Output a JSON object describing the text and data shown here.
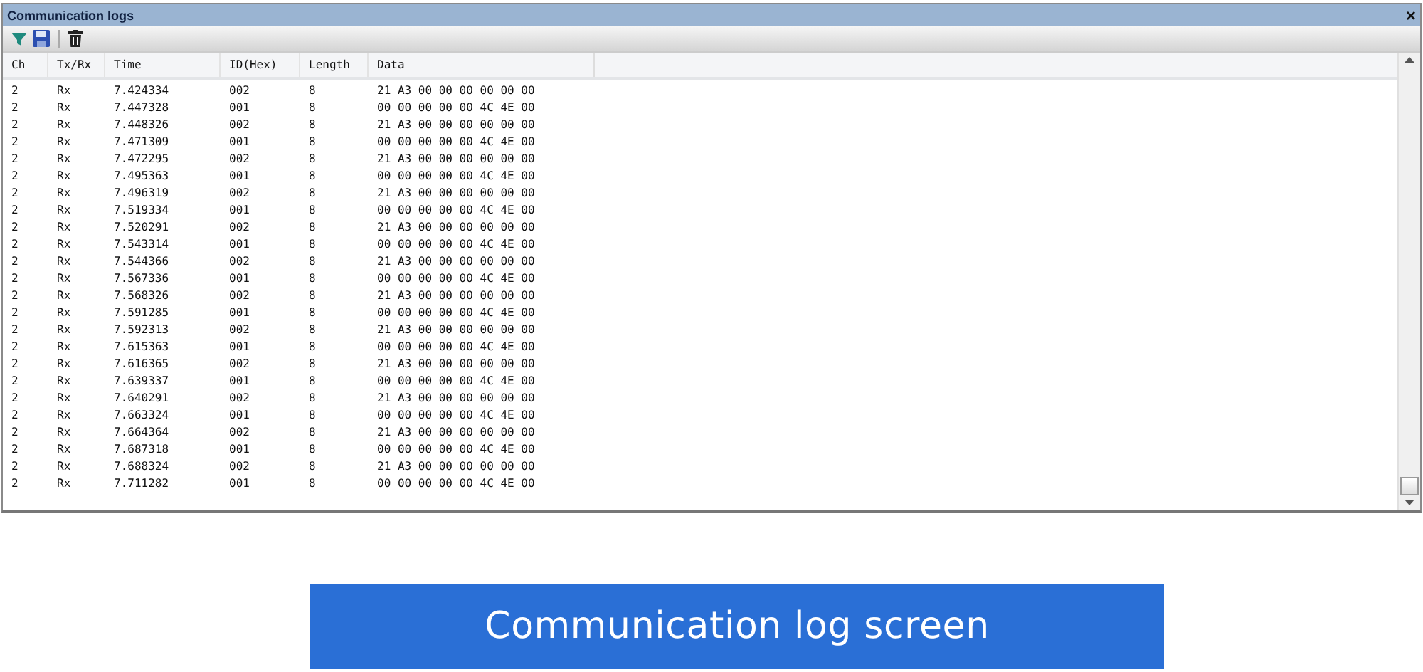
{
  "window": {
    "title": "Communication logs",
    "close": "×"
  },
  "table": {
    "columns": [
      "Ch",
      "Tx/Rx",
      "Time",
      "ID(Hex)",
      "Length",
      "Data"
    ],
    "rows": [
      [
        "2",
        "Rx",
        "7.424334",
        "002",
        "8",
        "21 A3 00 00 00 00 00 00"
      ],
      [
        "2",
        "Rx",
        "7.447328",
        "001",
        "8",
        "00 00 00 00 00 4C 4E 00"
      ],
      [
        "2",
        "Rx",
        "7.448326",
        "002",
        "8",
        "21 A3 00 00 00 00 00 00"
      ],
      [
        "2",
        "Rx",
        "7.471309",
        "001",
        "8",
        "00 00 00 00 00 4C 4E 00"
      ],
      [
        "2",
        "Rx",
        "7.472295",
        "002",
        "8",
        "21 A3 00 00 00 00 00 00"
      ],
      [
        "2",
        "Rx",
        "7.495363",
        "001",
        "8",
        "00 00 00 00 00 4C 4E 00"
      ],
      [
        "2",
        "Rx",
        "7.496319",
        "002",
        "8",
        "21 A3 00 00 00 00 00 00"
      ],
      [
        "2",
        "Rx",
        "7.519334",
        "001",
        "8",
        "00 00 00 00 00 4C 4E 00"
      ],
      [
        "2",
        "Rx",
        "7.520291",
        "002",
        "8",
        "21 A3 00 00 00 00 00 00"
      ],
      [
        "2",
        "Rx",
        "7.543314",
        "001",
        "8",
        "00 00 00 00 00 4C 4E 00"
      ],
      [
        "2",
        "Rx",
        "7.544366",
        "002",
        "8",
        "21 A3 00 00 00 00 00 00"
      ],
      [
        "2",
        "Rx",
        "7.567336",
        "001",
        "8",
        "00 00 00 00 00 4C 4E 00"
      ],
      [
        "2",
        "Rx",
        "7.568326",
        "002",
        "8",
        "21 A3 00 00 00 00 00 00"
      ],
      [
        "2",
        "Rx",
        "7.591285",
        "001",
        "8",
        "00 00 00 00 00 4C 4E 00"
      ],
      [
        "2",
        "Rx",
        "7.592313",
        "002",
        "8",
        "21 A3 00 00 00 00 00 00"
      ],
      [
        "2",
        "Rx",
        "7.615363",
        "001",
        "8",
        "00 00 00 00 00 4C 4E 00"
      ],
      [
        "2",
        "Rx",
        "7.616365",
        "002",
        "8",
        "21 A3 00 00 00 00 00 00"
      ],
      [
        "2",
        "Rx",
        "7.639337",
        "001",
        "8",
        "00 00 00 00 00 4C 4E 00"
      ],
      [
        "2",
        "Rx",
        "7.640291",
        "002",
        "8",
        "21 A3 00 00 00 00 00 00"
      ],
      [
        "2",
        "Rx",
        "7.663324",
        "001",
        "8",
        "00 00 00 00 00 4C 4E 00"
      ],
      [
        "2",
        "Rx",
        "7.664364",
        "002",
        "8",
        "21 A3 00 00 00 00 00 00"
      ],
      [
        "2",
        "Rx",
        "7.687318",
        "001",
        "8",
        "00 00 00 00 00 4C 4E 00"
      ],
      [
        "2",
        "Rx",
        "7.688324",
        "002",
        "8",
        "21 A3 00 00 00 00 00 00"
      ],
      [
        "2",
        "Rx",
        "7.711282",
        "001",
        "8",
        "00 00 00 00 00 4C 4E 00"
      ]
    ]
  },
  "caption": "Communication log screen"
}
